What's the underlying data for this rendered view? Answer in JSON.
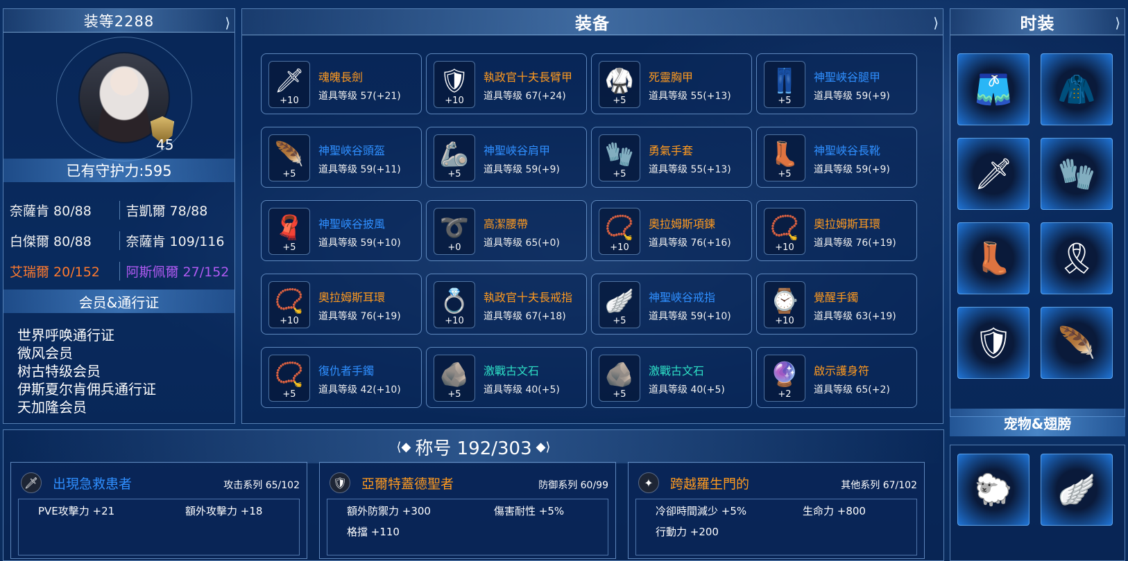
{
  "colors": {
    "orange_name": "#ff9a1f",
    "blue_name": "#2f8fff",
    "teal_name": "#2ee0c6",
    "accent_orange": "#ff7a2e",
    "accent_purple": "#b05af2"
  },
  "left": {
    "header": "装等2288",
    "level": "45",
    "guard": "已有守护力:595",
    "stats": [
      [
        {
          "label": "奈薩肯 80/88",
          "color": "normal"
        },
        {
          "label": "吉凱爾 78/88",
          "color": "normal"
        }
      ],
      [
        {
          "label": "白傑爾 80/88",
          "color": "normal"
        },
        {
          "label": "奈薩肯 109/116",
          "color": "normal"
        }
      ],
      [
        {
          "label": "艾瑞爾 20/152",
          "color": "orange"
        },
        {
          "label": "阿斯佩爾 27/152",
          "color": "purple"
        }
      ]
    ],
    "member_header": "会员&通行证",
    "members": [
      "世界呼唤通行证",
      "微风会员",
      "树古特级会员",
      "伊斯夏尔肯佣兵通行证",
      "天加隆会员"
    ]
  },
  "equip": {
    "header": "装备",
    "items": [
      {
        "name": "魂魄長劍",
        "level": "道具等级 57(+21)",
        "plus": "+10",
        "color": "orange",
        "icon": "sword-icon",
        "glyph": "🗡"
      },
      {
        "name": "執政官十夫長臂甲",
        "level": "道具等级 67(+24)",
        "plus": "+10",
        "color": "orange",
        "icon": "arm-guard-icon",
        "glyph": "🛡"
      },
      {
        "name": "死靈胸甲",
        "level": "道具等级 55(+13)",
        "plus": "+5",
        "color": "orange",
        "icon": "chest-armor-icon",
        "glyph": "🥋"
      },
      {
        "name": "神聖峽谷腿甲",
        "level": "道具等级 59(+9)",
        "plus": "+5",
        "color": "blue",
        "icon": "leg-armor-icon",
        "glyph": "👖"
      },
      {
        "name": "神聖峽谷頭盔",
        "level": "道具等级 59(+11)",
        "plus": "+5",
        "color": "blue",
        "icon": "helmet-icon",
        "glyph": "🪶"
      },
      {
        "name": "神聖峽谷肩甲",
        "level": "道具等级 59(+9)",
        "plus": "+5",
        "color": "blue",
        "icon": "shoulder-armor-icon",
        "glyph": "🦾"
      },
      {
        "name": "勇氣手套",
        "level": "道具等级 55(+13)",
        "plus": "+5",
        "color": "orange",
        "icon": "gloves-icon",
        "glyph": "🧤"
      },
      {
        "name": "神聖峽谷長靴",
        "level": "道具等级 59(+9)",
        "plus": "+5",
        "color": "blue",
        "icon": "boots-icon",
        "glyph": "👢"
      },
      {
        "name": "神聖峽谷披風",
        "level": "道具等级 59(+10)",
        "plus": "+5",
        "color": "blue",
        "icon": "cape-icon",
        "glyph": "🧣"
      },
      {
        "name": "高潔腰帶",
        "level": "道具等级 65(+0)",
        "plus": "+0",
        "color": "orange",
        "icon": "belt-icon",
        "glyph": "➰"
      },
      {
        "name": "奧拉姆斯項鍊",
        "level": "道具等级 76(+16)",
        "plus": "+10",
        "color": "orange",
        "icon": "necklace-icon",
        "glyph": "📿"
      },
      {
        "name": "奧拉姆斯耳環",
        "level": "道具等级 76(+19)",
        "plus": "+10",
        "color": "orange",
        "icon": "earring-icon",
        "glyph": "📿"
      },
      {
        "name": "奧拉姆斯耳環",
        "level": "道具等级 76(+19)",
        "plus": "+10",
        "color": "orange",
        "icon": "earring-icon",
        "glyph": "📿"
      },
      {
        "name": "執政官十夫長戒指",
        "level": "道具等级 67(+18)",
        "plus": "+10",
        "color": "orange",
        "icon": "ring-icon",
        "glyph": "💍"
      },
      {
        "name": "神聖峽谷戒指",
        "level": "道具等级 59(+10)",
        "plus": "+5",
        "color": "blue",
        "icon": "ring-icon",
        "glyph": "🪽"
      },
      {
        "name": "覺醒手鐲",
        "level": "道具等级 63(+19)",
        "plus": "+10",
        "color": "orange",
        "icon": "bracelet-icon",
        "glyph": "⌚"
      },
      {
        "name": "復仇者手鐲",
        "level": "道具等级 42(+10)",
        "plus": "+5",
        "color": "blue",
        "icon": "bracelet-icon",
        "glyph": "📿"
      },
      {
        "name": "激戰古文石",
        "level": "道具等级 40(+5)",
        "plus": "+5",
        "color": "teal",
        "icon": "rune-stone-icon",
        "glyph": "🪨"
      },
      {
        "name": "激戰古文石",
        "level": "道具等级 40(+5)",
        "plus": "+5",
        "color": "teal",
        "icon": "rune-stone-icon",
        "glyph": "🪨"
      },
      {
        "name": "啟示護身符",
        "level": "道具等级 65(+2)",
        "plus": "+2",
        "color": "orange",
        "icon": "amulet-icon",
        "glyph": "🔮"
      }
    ]
  },
  "fashion": {
    "header": "时装",
    "slots": [
      {
        "icon": "costume-pants-icon",
        "glyph": "🩳"
      },
      {
        "icon": "costume-top-icon",
        "glyph": "🧥"
      },
      {
        "icon": "costume-weapon-icon",
        "glyph": "🗡"
      },
      {
        "icon": "costume-gloves-icon",
        "glyph": "🧤"
      },
      {
        "icon": "costume-boots-icon",
        "glyph": "👢"
      },
      {
        "icon": "costume-cape-icon",
        "glyph": "🎗"
      },
      {
        "icon": "costume-shoulder-icon",
        "glyph": "🛡"
      },
      {
        "icon": "costume-accessory-icon",
        "glyph": "🪶"
      }
    ],
    "pet_header": "宠物&翅膀",
    "pets": [
      {
        "icon": "pet-icon",
        "glyph": "🐑"
      },
      {
        "icon": "wings-icon",
        "glyph": "🪽"
      }
    ]
  },
  "titles": {
    "header": "称号 192/303",
    "cards": [
      {
        "name": "出現急救患者",
        "category": "攻击系列 65/102",
        "icon": "sword-emblem-icon",
        "glyph": "🗡",
        "effects": [
          "PVE攻擊力 +21",
          "額外攻擊力 +18"
        ]
      },
      {
        "name": "亞爾特蓋德聖者",
        "category": "防御系列 60/99",
        "icon": "shield-emblem-icon",
        "glyph": "🛡",
        "effects": [
          "額外防禦力 +300",
          "傷害耐性 +5%",
          "格擋 +110"
        ]
      },
      {
        "name": "跨越羅生門的",
        "category": "其他系列 67/102",
        "icon": "star-emblem-icon",
        "glyph": "✦",
        "effects": [
          "冷卻時間減少 +5%",
          "生命力 +800",
          "行動力 +200"
        ]
      }
    ]
  }
}
